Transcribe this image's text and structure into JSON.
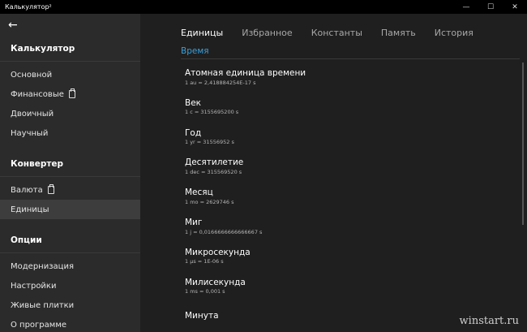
{
  "window": {
    "title": "Калькулятор²",
    "min_glyph": "—",
    "max_glyph": "☐",
    "close_glyph": "✕"
  },
  "sidebar": {
    "back_glyph": "←",
    "groups": [
      {
        "title": "Калькулятор",
        "items": [
          {
            "label": "Основной",
            "clip": false,
            "selected": false
          },
          {
            "label": "Финансовые",
            "clip": true,
            "selected": false
          },
          {
            "label": "Двоичный",
            "clip": false,
            "selected": false
          },
          {
            "label": "Научный",
            "clip": false,
            "selected": false
          }
        ]
      },
      {
        "title": "Конвертер",
        "items": [
          {
            "label": "Валюта",
            "clip": true,
            "selected": false
          },
          {
            "label": "Единицы",
            "clip": false,
            "selected": true
          }
        ]
      },
      {
        "title": "Опции",
        "items": [
          {
            "label": "Модернизация",
            "clip": false,
            "selected": false
          },
          {
            "label": "Настройки",
            "clip": false,
            "selected": false
          },
          {
            "label": "Живые плитки",
            "clip": false,
            "selected": false
          },
          {
            "label": "О программе",
            "clip": false,
            "selected": false
          }
        ]
      }
    ]
  },
  "main": {
    "tabs": [
      {
        "label": "Единицы",
        "active": true
      },
      {
        "label": "Избранное",
        "active": false
      },
      {
        "label": "Константы",
        "active": false
      },
      {
        "label": "Память",
        "active": false
      },
      {
        "label": "История",
        "active": false
      }
    ],
    "section": "Время",
    "units": [
      {
        "name": "Атомная единица времени",
        "value": "1 au = 2,418884254E-17 s"
      },
      {
        "name": "Век",
        "value": "1 c = 3155695200 s"
      },
      {
        "name": "Год",
        "value": "1 yr = 31556952 s"
      },
      {
        "name": "Десятилетие",
        "value": "1 dec = 315569520 s"
      },
      {
        "name": "Месяц",
        "value": "1 mo = 2629746 s"
      },
      {
        "name": "Миг",
        "value": "1 j = 0,0166666666666667 s"
      },
      {
        "name": "Микросекунда",
        "value": "1 µs = 1E-06 s"
      },
      {
        "name": "Милисекунда",
        "value": "1 ms = 0,001 s"
      },
      {
        "name": "Минута",
        "value": ""
      }
    ]
  },
  "watermark": "winstart.ru",
  "colors": {
    "accent": "#3a9fd9",
    "sidebar_bg": "#2b2b2b",
    "main_bg": "#1f1f1f",
    "titlebar_bg": "#000000"
  }
}
